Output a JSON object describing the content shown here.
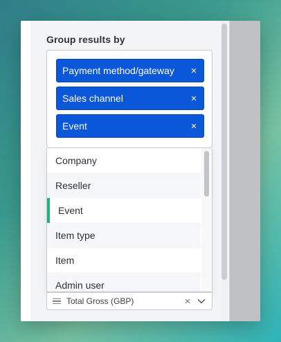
{
  "group_results": {
    "label": "Group results by",
    "selected": [
      {
        "label": "Payment method/gateway",
        "remove_icon": "×"
      },
      {
        "label": "Sales channel",
        "remove_icon": "×"
      },
      {
        "label": "Event",
        "remove_icon": "×"
      }
    ]
  },
  "dropdown": {
    "options": [
      "Company",
      "Reseller",
      "Event",
      "Item type",
      "Item",
      "Admin user"
    ],
    "active_option": "Event"
  },
  "metric": {
    "value": "Total Gross (GBP)",
    "clear_icon": "×",
    "drag_icon": "drag-handle-icon",
    "chevron_icon": "chevron-down-icon"
  },
  "colors": {
    "tag_background": "#0a57d9",
    "active_marker": "#1db37a"
  }
}
